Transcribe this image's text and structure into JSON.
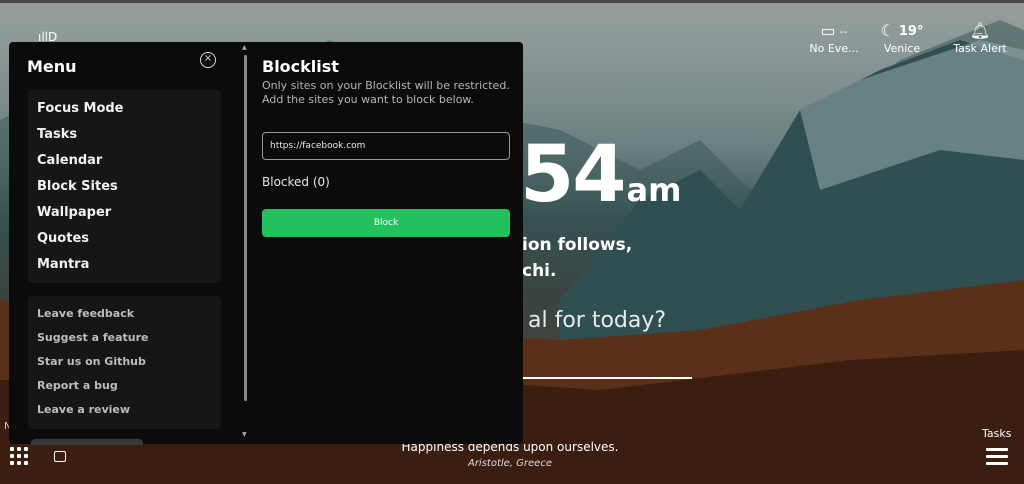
{
  "widgets": {
    "event": {
      "value": "--",
      "label": "No Eve..."
    },
    "weather": {
      "temp": "19°",
      "city": "Venice"
    },
    "alert": {
      "label": "Task Alert"
    }
  },
  "clock": {
    "time": "54",
    "ampm": "am"
  },
  "mantra": {
    "line1": "ion follows,",
    "line2": "chi."
  },
  "goal": {
    "question": "al for today?"
  },
  "quote": {
    "text": "Happiness depends upon ourselves.",
    "author": "Aristotle, Greece"
  },
  "bottom": {
    "tasks_label": "Tasks",
    "edge_text": "N"
  },
  "menu": {
    "title": "Menu",
    "close_glyph": "×",
    "items": [
      {
        "label": "Focus Mode"
      },
      {
        "label": "Tasks"
      },
      {
        "label": "Calendar"
      },
      {
        "label": "Block Sites"
      },
      {
        "label": "Wallpaper"
      },
      {
        "label": "Quotes"
      },
      {
        "label": "Mantra"
      }
    ],
    "links": [
      {
        "label": "Leave feedback"
      },
      {
        "label": "Suggest a feature"
      },
      {
        "label": "Star us on Github"
      },
      {
        "label": "Report a bug"
      },
      {
        "label": "Leave a review"
      }
    ]
  },
  "blocklist": {
    "title": "Blocklist",
    "description": "Only sites on your Blocklist will be restricted. Add the sites you want to block below.",
    "input_value": "https://facebook.com",
    "blocked_label": "Blocked (0)",
    "button_label": "Block",
    "button_color": "#21c25e"
  }
}
